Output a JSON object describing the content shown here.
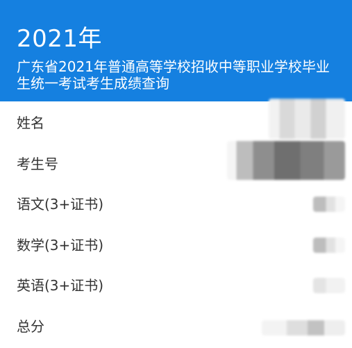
{
  "header": {
    "year": "2021年",
    "subtitle": "广东省2021年普通高等学校招收中等职业学校毕业生统一考试考生成绩查询",
    "background_color": "#1580e0"
  },
  "rows": [
    {
      "label": "姓名"
    },
    {
      "label": "考生号"
    },
    {
      "label": "语文(3+证书)"
    },
    {
      "label": "数学(3+证书)"
    },
    {
      "label": "英语(3+证书)"
    },
    {
      "label": "总分"
    }
  ]
}
